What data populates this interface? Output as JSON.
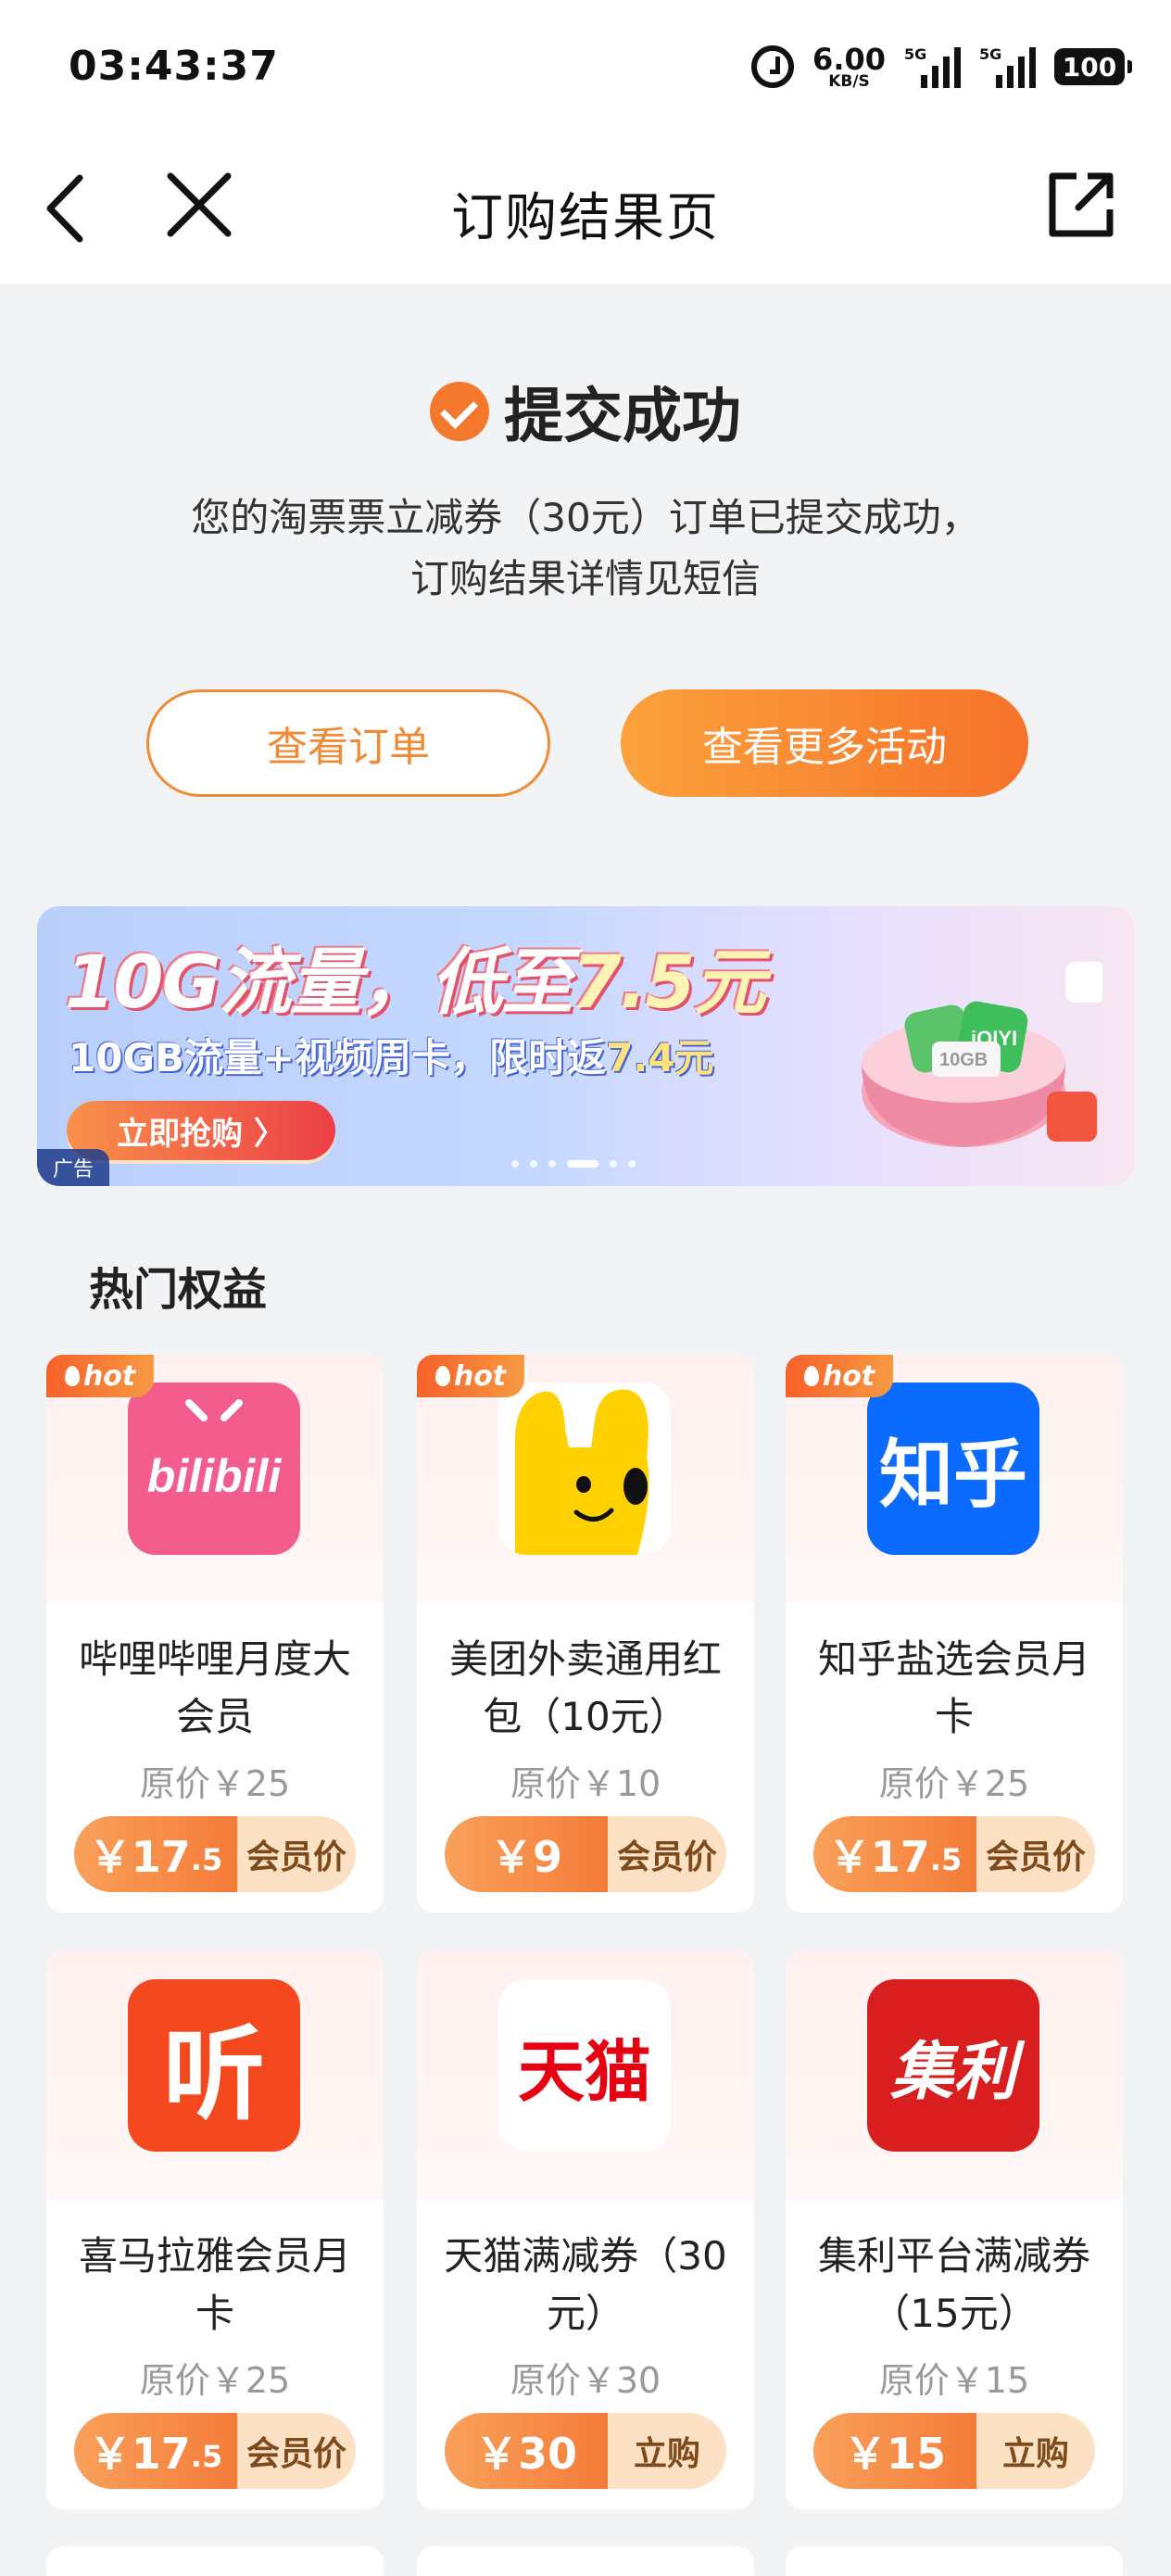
{
  "status_bar": {
    "time": "03:43:37",
    "speed_value": "6.00",
    "speed_unit": "KB/S",
    "signal1_label": "5G",
    "signal2_label": "5G",
    "battery": "100"
  },
  "nav": {
    "title": "订购结果页"
  },
  "result": {
    "title": "提交成功",
    "desc_line1": "您的淘票票立减券（30元）订单已提交成功，",
    "desc_line2": "订购结果详情见短信",
    "view_order_label": "查看订单",
    "more_activities_label": "查看更多活动"
  },
  "banner": {
    "headline_prefix": "10G流量，低至",
    "headline_accent": "7.5元",
    "sub_prefix": "10GB流量+视频周卡，限时返",
    "sub_accent": "7.4元",
    "cta_label": "立即抢购 〉",
    "ad_label": "广告",
    "slide_count": 6,
    "active_slide": 4,
    "gift_labels": [
      "iQIYI",
      "10GB"
    ]
  },
  "section": {
    "title": "热门权益"
  },
  "products": [
    {
      "hot": "hot",
      "logo_text": "bilibili",
      "name_line1": "哔哩哔哩月度大",
      "name_line2": "会员",
      "orig_price": "原价￥25",
      "price_main": "￥17",
      "price_small": ".5",
      "action": "会员价"
    },
    {
      "hot": "hot",
      "logo_text": "",
      "name_line1": "美团外卖通用红",
      "name_line2": "包（10元）",
      "orig_price": "原价￥10",
      "price_main": "￥9",
      "price_small": "",
      "action": "会员价"
    },
    {
      "hot": "hot",
      "logo_text": "知乎",
      "name_line1": "知乎盐选会员月",
      "name_line2": "卡",
      "orig_price": "原价￥25",
      "price_main": "￥17",
      "price_small": ".5",
      "action": "会员价"
    },
    {
      "hot": "",
      "logo_text": "听",
      "name_line1": "喜马拉雅会员月",
      "name_line2": "卡",
      "orig_price": "原价￥25",
      "price_main": "￥17",
      "price_small": ".5",
      "action": "会员价"
    },
    {
      "hot": "",
      "logo_text": "天猫",
      "name_line1": "天猫满减券（30",
      "name_line2": "元）",
      "orig_price": "原价￥30",
      "price_main": "￥30",
      "price_small": "",
      "action": "立购"
    },
    {
      "hot": "",
      "logo_text": "集利",
      "name_line1": "集利平台满减券",
      "name_line2": "（15元）",
      "orig_price": "原价￥15",
      "price_main": "￥15",
      "price_small": "",
      "action": "立购"
    }
  ],
  "colors": {
    "accent": "#f4782b",
    "page_bg": "#f2f3f5",
    "bilibili": "#f25d8e",
    "meituan": "#ffd100",
    "zhihu": "#0b6bff",
    "ximalaya": "#f4481e",
    "tmall": "#e60012",
    "jili": "#d81e1e"
  }
}
